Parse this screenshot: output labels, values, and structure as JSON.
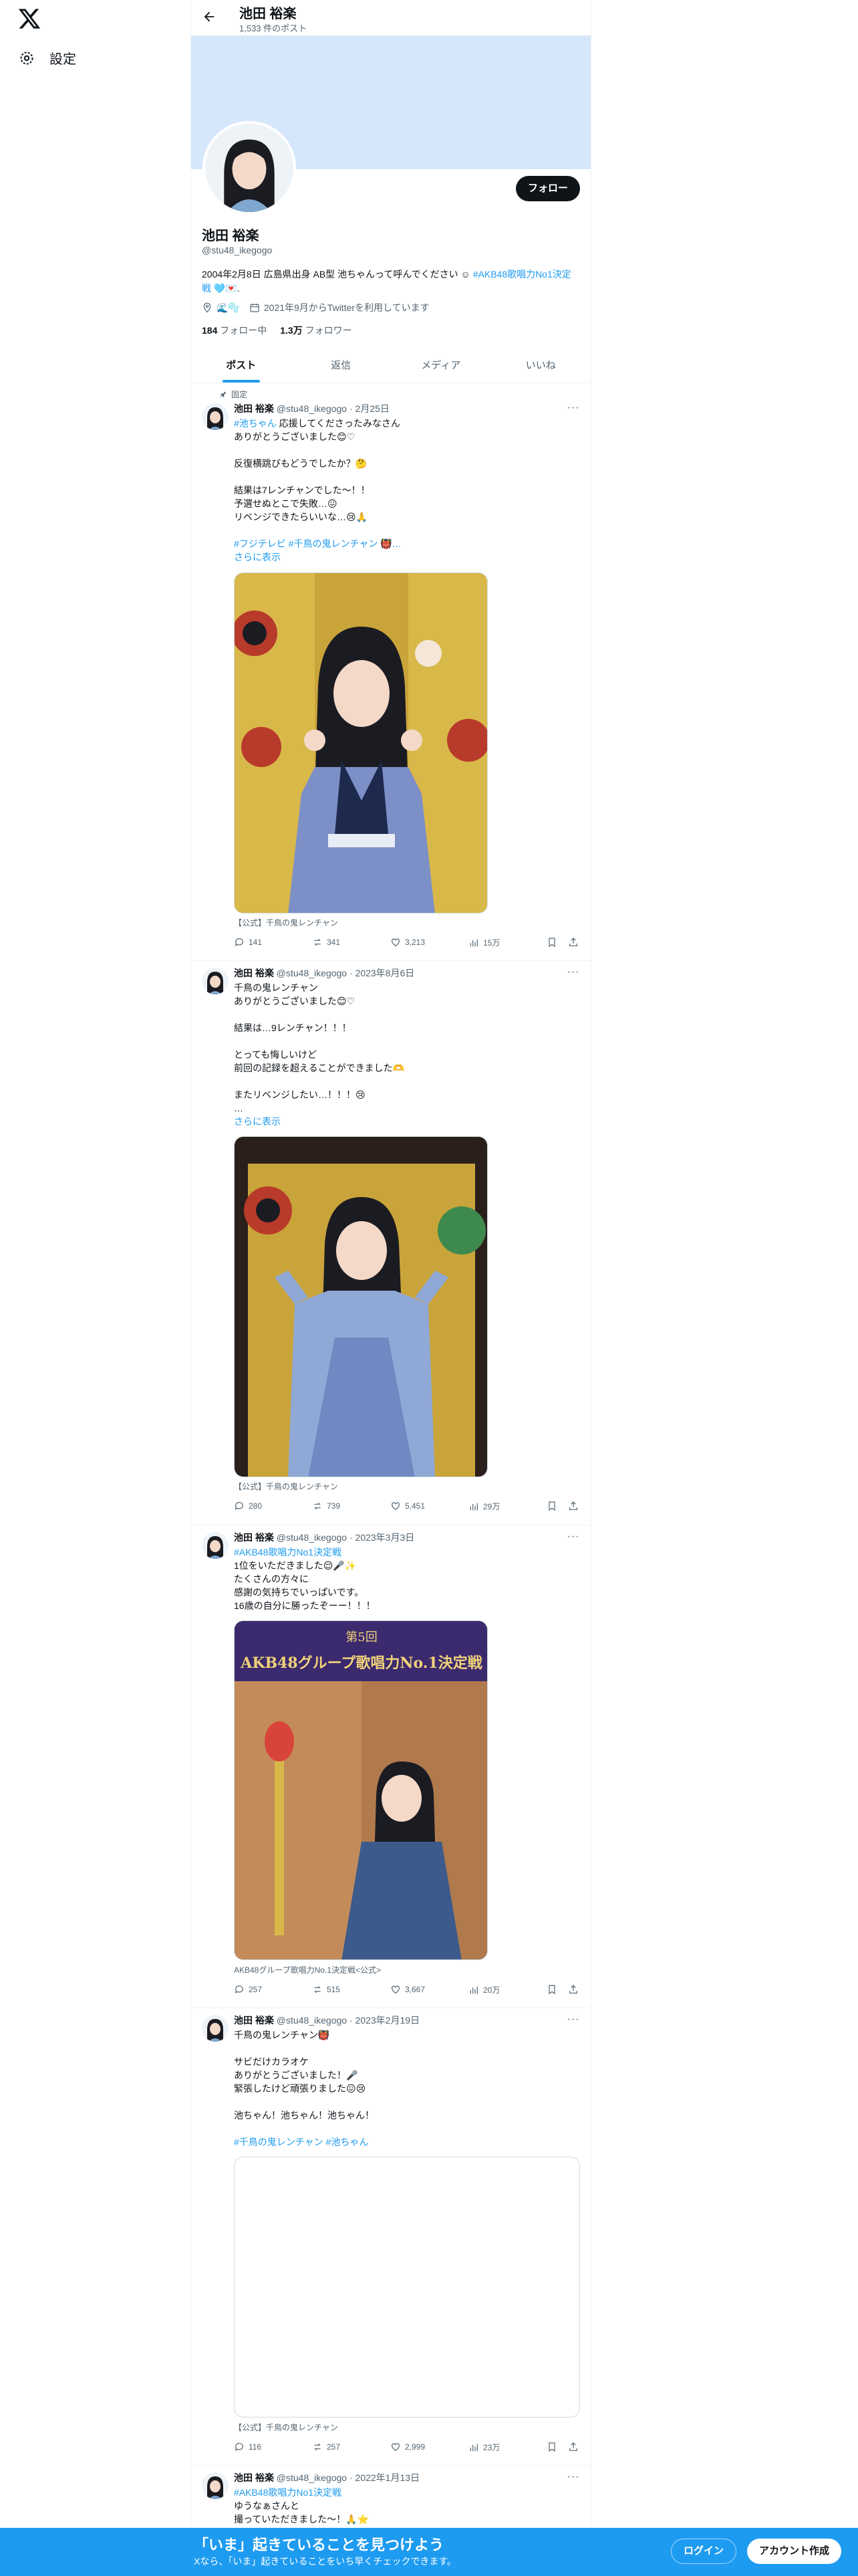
{
  "nav": {
    "settings_label": "設定"
  },
  "header": {
    "name": "池田 裕楽",
    "post_count": "1,533 件のポスト"
  },
  "profile": {
    "follow_label": "フォロー",
    "name": "池田 裕楽",
    "handle": "@stu48_ikegogo",
    "bio_text": "2004年2月8日 広島県出身 AB型 池ちゃんって呼んでください ☺︎",
    "bio_hashtag": "#AKB48歌唱力No1決定戦",
    "bio_emoji": " 🩵💌.",
    "location_emoji": "🌊🫧",
    "joined": "2021年9月からTwitterを利用しています",
    "following_count": "184",
    "following_label": "フォロー中",
    "followers_count": "1.3万",
    "followers_label": "フォロワー"
  },
  "tabs": [
    "ポスト",
    "返信",
    "メディア",
    "いいね"
  ],
  "posts": [
    {
      "pinned_label": "固定",
      "name": "池田 裕楽",
      "handle": "@stu48_ikegogo",
      "date": "2月25日",
      "tag_line": "#池ちゃん",
      "text_after_tag": " 応援してくださったみなさん",
      "body": "ありがとうございました😊♡\n\n反復横跳びもどうでしたか？🤔\n\n結果は7レンチャンでした〜！！\n予選せぬとこで失敗…😖\nリベンジできたらいいな…😢🙏",
      "hashtags": "#フジテレビ #千鳥の鬼レンチャン 👹…",
      "show_more": "さらに表示",
      "caption": "【公式】千鳥の鬼レンチャン",
      "replies": "141",
      "reposts": "341",
      "likes": "3,213",
      "views": "15万"
    },
    {
      "name": "池田 裕楽",
      "handle": "@stu48_ikegogo",
      "date": "2023年8月6日",
      "body": "千鳥の鬼レンチャン\nありがとうございました😊♡\n\n結果は…9レンチャン！！！\n\nとっても悔しいけど\n前回の記録を超えることができました🫶\n\nまたリベンジしたい…！！！😢\n…",
      "show_more": "さらに表示",
      "caption": "【公式】千鳥の鬼レンチャン",
      "replies": "280",
      "reposts": "739",
      "likes": "5,451",
      "views": "29万"
    },
    {
      "name": "池田 裕楽",
      "handle": "@stu48_ikegogo",
      "date": "2023年3月3日",
      "hashtags": "#AKB48歌唱力No1決定戦",
      "body": "1位をいただきました😌🎤✨\nたくさんの方々に\n感謝の気持ちでいっぱいです。\n16歳の自分に勝ったぞーー！！！",
      "media_banner_line1": "第5回",
      "media_banner_line2": "AKB48グループ歌唱力No.1決定戦",
      "caption": "AKB48グループ歌唱力No.1決定戦<公式>",
      "replies": "257",
      "reposts": "515",
      "likes": "3,667",
      "views": "20万"
    },
    {
      "name": "池田 裕楽",
      "handle": "@stu48_ikegogo",
      "date": "2023年2月19日",
      "body": "千鳥の鬼レンチャン👹\n\nサビだけカラオケ\nありがとうございました！🎤\n緊張したけど頑張りました😖😢\n\n池ちゃん！池ちゃん！池ちゃん！",
      "hashtags": "#千鳥の鬼レンチャン #池ちゃん",
      "caption": "【公式】千鳥の鬼レンチャン",
      "replies": "116",
      "reposts": "257",
      "likes": "2,999",
      "views": "23万"
    },
    {
      "name": "池田 裕楽",
      "handle": "@stu48_ikegogo",
      "date": "2022年1月13日",
      "hashtags": "#AKB48歌唱力No1決定戦",
      "body": "ゆうなぁさんと\n撮っていただきました〜！🙏⭐"
    }
  ],
  "bottom_bar": {
    "title": "「いま」起きていることを見つけよう",
    "subtitle": "Xなら、「いま」起きていることをいち早くチェックできます。",
    "login_label": "ログイン",
    "signup_label": "アカウント作成"
  }
}
